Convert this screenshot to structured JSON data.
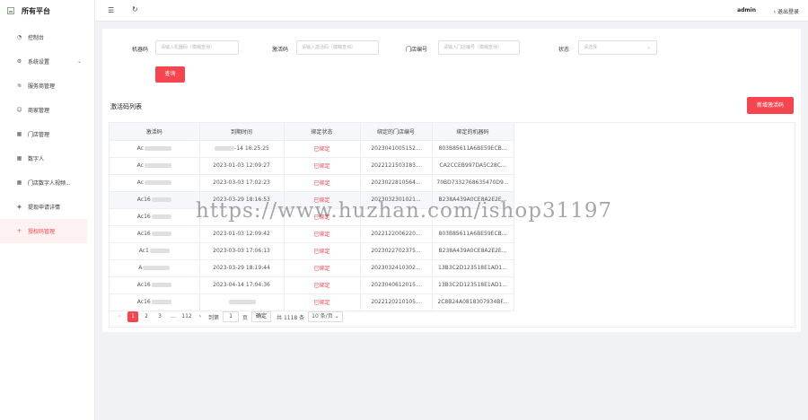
{
  "app": {
    "title": "所有平台"
  },
  "header": {
    "user": "admin",
    "logout": "退出登录"
  },
  "sidebar": {
    "items": [
      {
        "label": "控制台",
        "icon": "dashboard-icon",
        "glyph": "◔"
      },
      {
        "label": "系统设置",
        "icon": "gear-icon",
        "glyph": "⚙",
        "chevron": "⌄"
      },
      {
        "label": "服务商管理",
        "icon": "wifi-icon",
        "glyph": "≋"
      },
      {
        "label": "商家管理",
        "icon": "smile-icon",
        "glyph": "☺"
      },
      {
        "label": "门店管理",
        "icon": "store-icon",
        "glyph": "▦"
      },
      {
        "label": "数字人",
        "icon": "digital-human-icon",
        "glyph": "▦"
      },
      {
        "label": "门店数字人视频...",
        "icon": "video-icon",
        "glyph": "▦"
      },
      {
        "label": "提现申请详情",
        "icon": "layers-icon",
        "glyph": "◈"
      },
      {
        "label": "授权码管理",
        "icon": "plus-icon",
        "glyph": "+"
      }
    ]
  },
  "filters": {
    "machine_code": {
      "label": "机器码",
      "placeholder": "请输入机器码（模糊查询）"
    },
    "activation_code": {
      "label": "激活码",
      "placeholder": "请输入激活码（模糊查询）"
    },
    "store_no": {
      "label": "门店编号",
      "placeholder": "请输入门店编号（模糊查询）"
    },
    "status": {
      "label": "状态",
      "placeholder": "请选择"
    },
    "query_button": "查询"
  },
  "list": {
    "title": "激活码列表",
    "add_button": "新增激活码",
    "columns": [
      "激活码",
      "到期时间",
      "绑定状态",
      "绑定的门店编号",
      "绑定的机器码"
    ],
    "rows": [
      {
        "code": "Ac",
        "expire": "-14 16:25:25",
        "status": "已绑定",
        "store": "2023041005152...",
        "machine": "803B85611A6BE59ECB..."
      },
      {
        "code": "Ac",
        "expire": "2023-01-03 12:09:27",
        "status": "已绑定",
        "store": "2022121503183...",
        "machine": "CA2CCEB997DA5C28C..."
      },
      {
        "code": "Ac",
        "expire": "2023-03-03 17:02:23",
        "status": "已绑定",
        "store": "2023022810564...",
        "machine": "70BD7332768635470D9..."
      },
      {
        "code": "Ac16",
        "expire": "2023-03-29 18:16:53",
        "status": "已绑定",
        "store": "2023032301021...",
        "machine": "B238A439A0CE8A2E2E..."
      },
      {
        "code": "Ac16",
        "expire": "",
        "status": "已绑定",
        "store": "",
        "machine": ""
      },
      {
        "code": "Ac16",
        "expire": "2023-01-03 12:09:42",
        "status": "已绑定",
        "store": "2022122006220...",
        "machine": "803B85611A6BE59ECB..."
      },
      {
        "code": "Ac1",
        "expire": "2023-03-03 17:06:13",
        "status": "已绑定",
        "store": "2023022702375...",
        "machine": "B238A439A0CE8A2E2E..."
      },
      {
        "code": "A",
        "expire": "2023-03-29 18:19:44",
        "status": "已绑定",
        "store": "2023032410302...",
        "machine": "13B3C2D123518E1AD1..."
      },
      {
        "code": "Ac16",
        "expire": "2023-04-14 17:04:36",
        "status": "已绑定",
        "store": "2023040612015...",
        "machine": "13B3C2D123518E1AD1..."
      },
      {
        "code": "Ac16",
        "expire": "",
        "status": "已绑定",
        "store": "2022120210105...",
        "machine": "2C8B24A0818307934BF..."
      }
    ]
  },
  "pagination": {
    "prev": "‹",
    "pages": [
      "1",
      "2",
      "3",
      "...",
      "112"
    ],
    "current": "1",
    "next": "›",
    "goto_label": "到第",
    "goto_value": "1",
    "page_unit": "页",
    "confirm": "确定",
    "total": "共 1118 条",
    "page_size": "10 条/页"
  },
  "watermark": "https://www.huzhan.com/ishop31197"
}
